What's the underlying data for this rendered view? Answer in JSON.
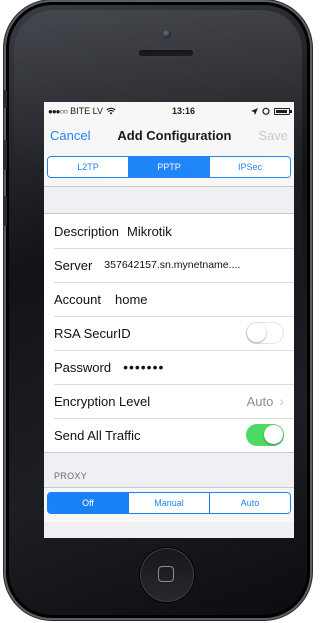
{
  "status_bar": {
    "carrier": "BITE LV",
    "time": "13:16"
  },
  "nav": {
    "cancel": "Cancel",
    "title": "Add Configuration",
    "save": "Save"
  },
  "vpn_types": {
    "options": [
      "L2TP",
      "PPTP",
      "IPSec"
    ],
    "selected": "PPTP"
  },
  "form": {
    "description": {
      "label": "Description",
      "value": "Mikrotik"
    },
    "server": {
      "label": "Server",
      "value": "357642157.sn.mynetname...."
    },
    "account": {
      "label": "Account",
      "value": "home"
    },
    "rsa": {
      "label": "RSA SecurID",
      "on": false
    },
    "password": {
      "label": "Password",
      "value": "•••••••"
    },
    "encryption": {
      "label": "Encryption Level",
      "value": "Auto"
    },
    "send_all": {
      "label": "Send All Traffic",
      "on": true
    }
  },
  "proxy": {
    "header": "PROXY",
    "options": [
      "Off",
      "Manual",
      "Auto"
    ],
    "selected": "Off"
  },
  "colors": {
    "accent": "#1a82f7",
    "toggle_on": "#4cd964",
    "disabled": "#c7c7cc"
  }
}
